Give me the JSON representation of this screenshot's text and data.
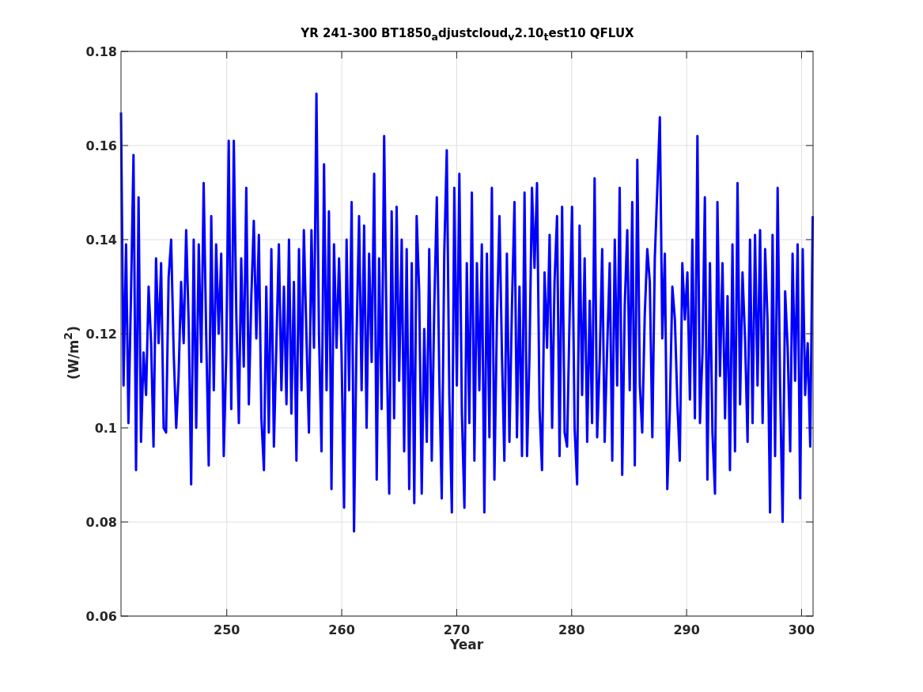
{
  "chart": {
    "chart_data": {
      "type": "line",
      "title": "YR 241-300 BT1850$_{a}$djustcloud$_{v}$2.10$_{t}$est10 QFLUX",
      "xlabel": "Year",
      "ylabel": "(W/m$^{2}$)",
      "xlim": [
        240.8,
        301
      ],
      "ylim": [
        0.06,
        0.18
      ],
      "grid": true,
      "xticks": [
        {
          "value": 250,
          "label": "250"
        },
        {
          "value": 260,
          "label": "260"
        },
        {
          "value": 270,
          "label": "270"
        },
        {
          "value": 280,
          "label": "280"
        },
        {
          "value": 290,
          "label": "290"
        },
        {
          "value": 300,
          "label": "300"
        }
      ],
      "x": [
        240.8,
        241.02,
        241.24,
        241.45,
        241.67,
        241.89,
        242.11,
        242.33,
        242.54,
        242.76,
        242.98,
        243.2,
        243.42,
        243.63,
        243.85,
        244.07,
        244.29,
        244.51,
        244.72,
        244.94,
        245.16,
        245.38,
        245.6,
        245.81,
        246.03,
        246.25,
        246.47,
        246.69,
        246.9,
        247.12,
        247.34,
        247.56,
        247.78,
        247.99,
        248.21,
        248.43,
        248.65,
        248.87,
        249.08,
        249.3,
        249.52,
        249.74,
        249.96,
        250.17,
        250.39,
        250.61,
        250.83,
        251.05,
        251.26,
        251.48,
        251.7,
        251.92,
        252.14,
        252.35,
        252.57,
        252.79,
        253.01,
        253.23,
        253.44,
        253.66,
        253.88,
        254.1,
        254.32,
        254.53,
        254.75,
        254.97,
        255.19,
        255.41,
        255.62,
        255.84,
        256.06,
        256.28,
        256.5,
        256.71,
        256.93,
        257.15,
        257.37,
        257.59,
        257.8,
        258.02,
        258.24,
        258.46,
        258.68,
        258.89,
        259.11,
        259.33,
        259.55,
        259.77,
        259.98,
        260.2,
        260.42,
        260.64,
        260.86,
        261.07,
        261.29,
        261.51,
        261.73,
        261.95,
        262.16,
        262.38,
        262.6,
        262.82,
        263.04,
        263.25,
        263.47,
        263.69,
        263.91,
        264.13,
        264.34,
        264.56,
        264.78,
        265.0,
        265.22,
        265.43,
        265.65,
        265.87,
        266.09,
        266.31,
        266.52,
        266.74,
        266.96,
        267.18,
        267.4,
        267.61,
        267.83,
        268.05,
        268.27,
        268.49,
        268.7,
        268.92,
        269.14,
        269.36,
        269.58,
        269.79,
        270.01,
        270.23,
        270.45,
        270.67,
        270.88,
        271.1,
        271.32,
        271.54,
        271.76,
        271.97,
        272.19,
        272.41,
        272.63,
        272.85,
        273.06,
        273.28,
        273.5,
        273.72,
        273.94,
        274.15,
        274.37,
        274.59,
        274.81,
        275.03,
        275.24,
        275.46,
        275.68,
        275.9,
        276.12,
        276.33,
        276.55,
        276.77,
        276.99,
        277.21,
        277.42,
        277.64,
        277.86,
        278.08,
        278.3,
        278.51,
        278.73,
        278.95,
        279.17,
        279.39,
        279.6,
        279.82,
        280.04,
        280.26,
        280.48,
        280.69,
        280.91,
        281.13,
        281.35,
        281.57,
        281.78,
        282.0,
        282.22,
        282.44,
        282.66,
        282.87,
        283.09,
        283.31,
        283.53,
        283.75,
        283.96,
        284.18,
        284.4,
        284.62,
        284.84,
        285.05,
        285.27,
        285.49,
        285.71,
        285.93,
        286.14,
        286.36,
        286.58,
        286.8,
        287.02,
        287.23,
        287.45,
        287.67,
        287.89,
        288.11,
        288.32,
        288.54,
        288.76,
        288.98,
        289.2,
        289.41,
        289.63,
        289.85,
        290.07,
        290.29,
        290.5,
        290.72,
        290.94,
        291.16,
        291.38,
        291.59,
        291.81,
        292.03,
        292.25,
        292.47,
        292.68,
        292.9,
        293.12,
        293.34,
        293.56,
        293.77,
        293.99,
        294.21,
        294.43,
        294.65,
        294.86,
        295.08,
        295.3,
        295.52,
        295.74,
        295.95,
        296.17,
        296.39,
        296.61,
        296.83,
        297.04,
        297.26,
        297.48,
        297.7,
        297.92,
        298.13,
        298.35,
        298.57,
        298.79,
        299.01,
        299.22,
        299.44,
        299.66,
        299.88,
        300.1,
        300.31,
        300.53,
        300.75,
        300.97
      ],
      "yticks": [
        {
          "value": 0.06,
          "label": "0.06"
        },
        {
          "value": 0.08,
          "label": "0.08"
        },
        {
          "value": 0.1,
          "label": "0.1"
        },
        {
          "value": 0.12,
          "label": "0.12"
        },
        {
          "value": 0.14,
          "label": "0.14"
        },
        {
          "value": 0.16,
          "label": "0.16"
        },
        {
          "value": 0.18,
          "label": "0.18"
        }
      ],
      "series": [
        {
          "color": "#0000ff",
          "values": [
            0.167,
            0.109,
            0.139,
            0.101,
            0.128,
            0.158,
            0.091,
            0.149,
            0.097,
            0.116,
            0.107,
            0.13,
            0.118,
            0.096,
            0.136,
            0.118,
            0.135,
            0.1,
            0.099,
            0.132,
            0.14,
            0.116,
            0.1,
            0.111,
            0.131,
            0.118,
            0.142,
            0.122,
            0.088,
            0.14,
            0.1,
            0.139,
            0.114,
            0.152,
            0.12,
            0.092,
            0.145,
            0.108,
            0.139,
            0.12,
            0.137,
            0.094,
            0.116,
            0.161,
            0.104,
            0.161,
            0.124,
            0.101,
            0.136,
            0.113,
            0.151,
            0.105,
            0.128,
            0.144,
            0.119,
            0.141,
            0.102,
            0.091,
            0.13,
            0.099,
            0.138,
            0.096,
            0.118,
            0.139,
            0.108,
            0.13,
            0.105,
            0.14,
            0.103,
            0.131,
            0.093,
            0.138,
            0.108,
            0.142,
            0.12,
            0.099,
            0.142,
            0.117,
            0.171,
            0.12,
            0.095,
            0.156,
            0.108,
            0.146,
            0.087,
            0.139,
            0.117,
            0.136,
            0.116,
            0.083,
            0.14,
            0.108,
            0.148,
            0.078,
            0.119,
            0.145,
            0.108,
            0.143,
            0.1,
            0.137,
            0.114,
            0.154,
            0.089,
            0.136,
            0.104,
            0.162,
            0.118,
            0.086,
            0.146,
            0.102,
            0.147,
            0.11,
            0.14,
            0.095,
            0.138,
            0.087,
            0.135,
            0.084,
            0.145,
            0.129,
            0.086,
            0.121,
            0.097,
            0.138,
            0.093,
            0.126,
            0.149,
            0.11,
            0.085,
            0.137,
            0.159,
            0.107,
            0.082,
            0.151,
            0.109,
            0.154,
            0.103,
            0.083,
            0.135,
            0.101,
            0.15,
            0.093,
            0.135,
            0.108,
            0.139,
            0.082,
            0.137,
            0.098,
            0.151,
            0.089,
            0.123,
            0.145,
            0.115,
            0.093,
            0.137,
            0.097,
            0.126,
            0.148,
            0.098,
            0.13,
            0.094,
            0.15,
            0.094,
            0.115,
            0.151,
            0.134,
            0.152,
            0.104,
            0.091,
            0.133,
            0.117,
            0.141,
            0.1,
            0.131,
            0.145,
            0.094,
            0.147,
            0.099,
            0.096,
            0.124,
            0.147,
            0.1,
            0.088,
            0.143,
            0.107,
            0.136,
            0.097,
            0.127,
            0.101,
            0.153,
            0.098,
            0.114,
            0.138,
            0.097,
            0.117,
            0.135,
            0.093,
            0.14,
            0.109,
            0.151,
            0.09,
            0.126,
            0.142,
            0.108,
            0.148,
            0.092,
            0.157,
            0.109,
            0.099,
            0.124,
            0.138,
            0.131,
            0.098,
            0.136,
            0.151,
            0.166,
            0.119,
            0.137,
            0.087,
            0.104,
            0.13,
            0.123,
            0.105,
            0.093,
            0.135,
            0.123,
            0.133,
            0.106,
            0.14,
            0.102,
            0.162,
            0.101,
            0.116,
            0.149,
            0.089,
            0.135,
            0.099,
            0.086,
            0.148,
            0.111,
            0.135,
            0.102,
            0.128,
            0.091,
            0.139,
            0.095,
            0.152,
            0.105,
            0.133,
            0.119,
            0.097,
            0.14,
            0.101,
            0.141,
            0.109,
            0.142,
            0.101,
            0.138,
            0.123,
            0.082,
            0.141,
            0.094,
            0.151,
            0.109,
            0.08,
            0.129,
            0.117,
            0.095,
            0.137,
            0.11,
            0.139,
            0.085,
            0.138,
            0.107,
            0.118,
            0.096,
            0.145
          ]
        }
      ]
    }
  }
}
